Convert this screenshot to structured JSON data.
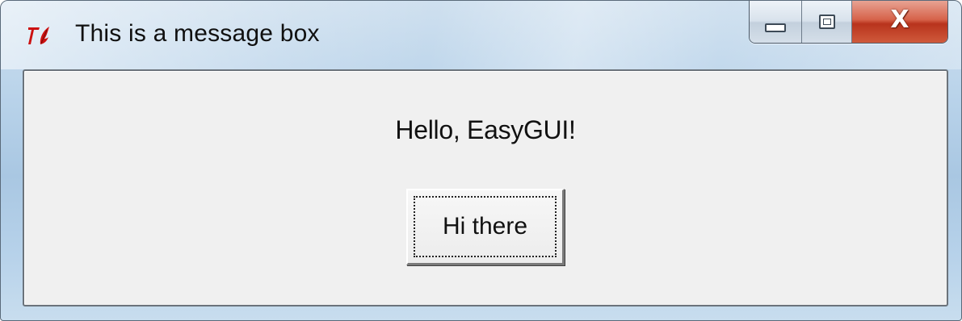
{
  "window": {
    "title": "This is a message box",
    "app_icon": "tk-feather-icon",
    "caption_buttons": {
      "minimize_icon": "minimize-icon",
      "maximize_icon": "maximize-icon",
      "close_glyph": "X"
    }
  },
  "body": {
    "message": "Hello, EasyGUI!",
    "button_label": "Hi there"
  },
  "colors": {
    "close_button": "#c8432a",
    "client_background": "#f0f0f0",
    "title_accent": "#cc1111"
  }
}
